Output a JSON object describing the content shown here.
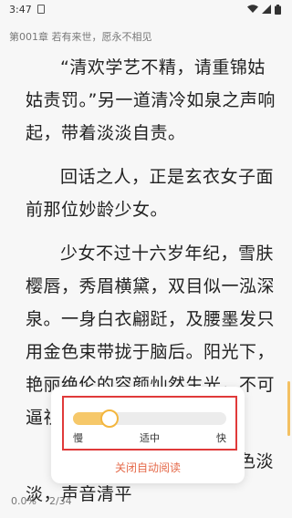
{
  "status_bar": {
    "time": "3:47",
    "icons": [
      "sim-card-icon",
      "wifi-icon",
      "signal-icon",
      "battery-icon"
    ]
  },
  "chapter": {
    "header": "第001章 若有来世，愿永不相见"
  },
  "paragraphs": [
    "“清欢学艺不精，请重锦姑姑责罚。”另一道清冷如泉之声响起，带着淡淡自责。",
    "回话之人，正是玄衣女子面前那位妙龄少女。",
    "少女不过十六岁年纪，雪肤樱唇，秀眉横黛，双目似一泓深泉。一身白衣翩跹，及腰墨发只用金色束带拢于脑后。阳光下，艳丽绝伦的容颜灿然生光，不可逼视。",
    "玄衣女子收剑入鞘，神色淡淡，声音清平"
  ],
  "auto_read_popup": {
    "speed_level": 0.2,
    "labels": {
      "slow": "慢",
      "medium": "适中",
      "fast": "快"
    },
    "close_label": "关闭自动阅读"
  },
  "footer": {
    "progress": "0.0%",
    "page": "2/34"
  },
  "colors": {
    "background": "#f7f7f7",
    "accent": "#f3b63f",
    "highlight_border": "#e03a3a",
    "close_text": "#e56a4a"
  }
}
